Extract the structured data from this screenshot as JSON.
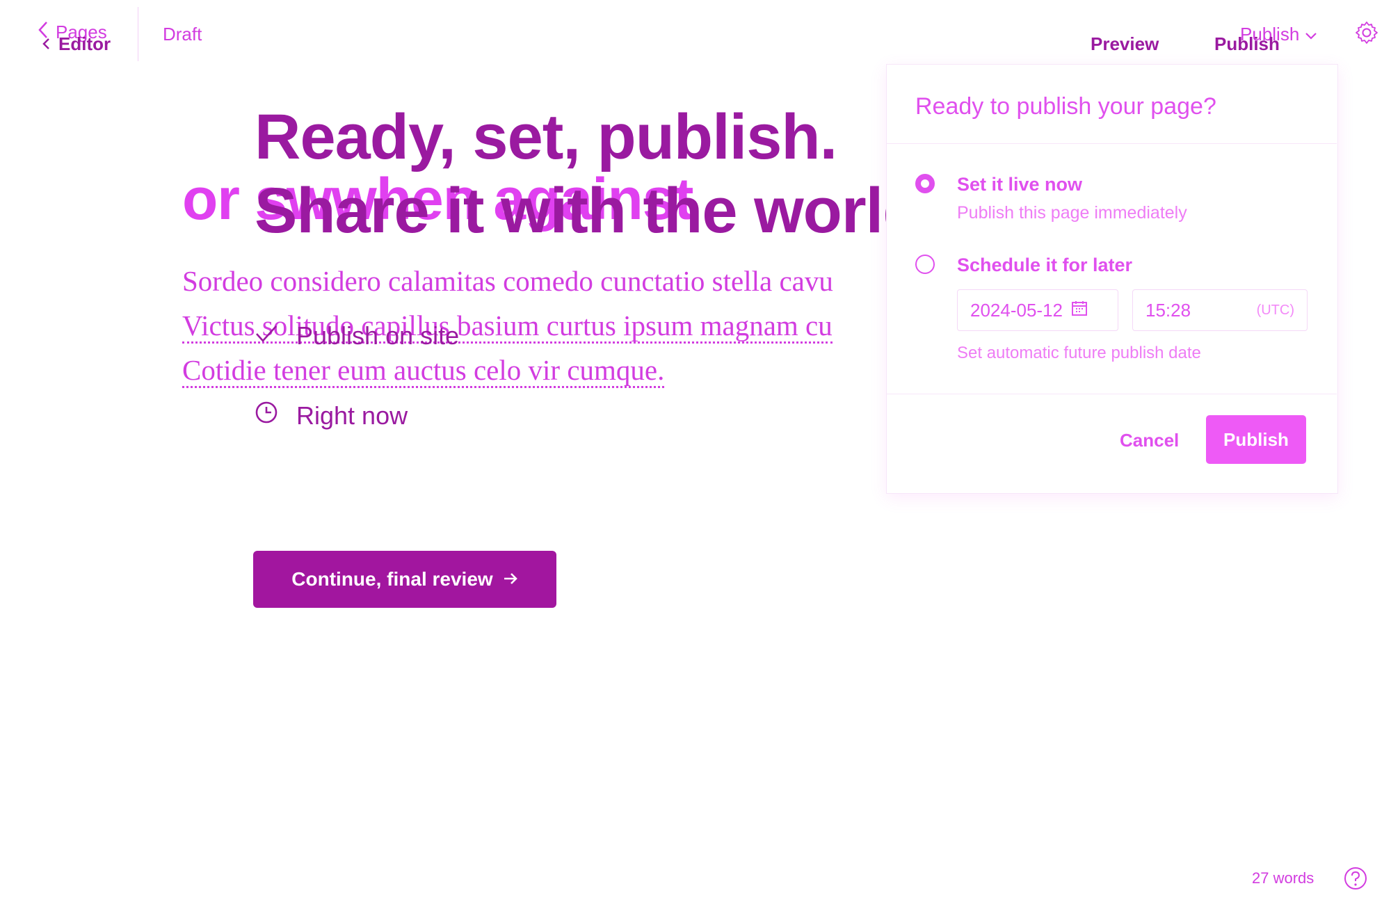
{
  "editor": {
    "back_label": "Pages",
    "status": "Draft",
    "publish_menu": "Publish",
    "headline": "or swwhen against",
    "paragraph_lines": [
      "Sordeo considero calamitas comedo cunctatio stella cavu",
      "Victus solitudo capillus basium curtus ipsum magnam cu",
      "Cotidie tener eum auctus celo vir cumque."
    ],
    "word_count": "27 words"
  },
  "wizard": {
    "back_label": "Editor",
    "preview_label": "Preview",
    "publish_label": "Publish",
    "title_line1": "Ready, set, publish.",
    "title_line2": "Share it with the world.",
    "option_site": "Publish on site",
    "option_time": "Right now",
    "continue_label": "Continue, final review"
  },
  "popover": {
    "title": "Ready to publish your page?",
    "option_now_title": "Set it live now",
    "option_now_desc": "Publish this page immediately",
    "option_later_title": "Schedule it for later",
    "date_value": "2024-05-12",
    "time_value": "15:28",
    "timezone": "(UTC)",
    "schedule_help": "Set automatic future publish date",
    "cancel_label": "Cancel",
    "publish_label": "Publish"
  },
  "colors": {
    "editor_accent": "#d23ce0",
    "wizard_accent": "#9a1aa0",
    "popover_accent": "#ee5af6"
  }
}
